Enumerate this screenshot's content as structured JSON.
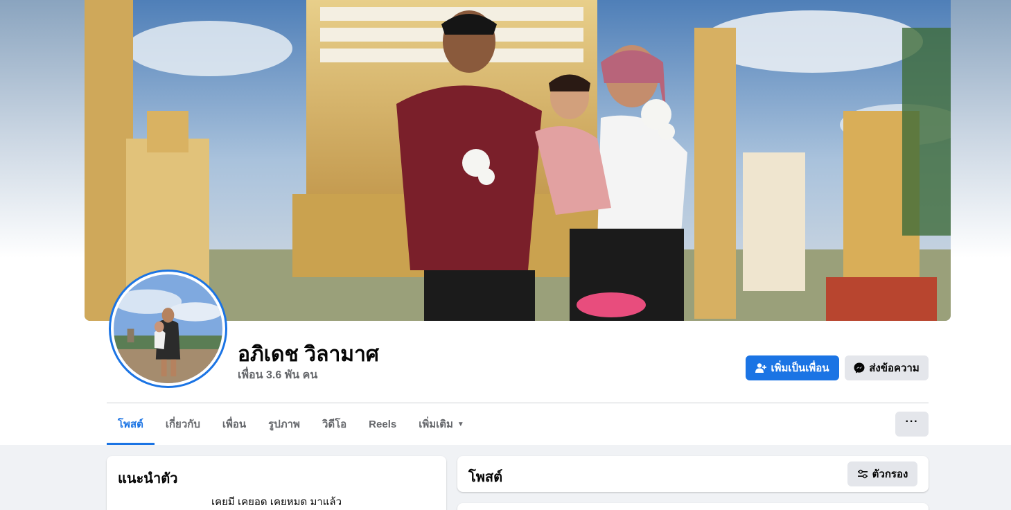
{
  "profile": {
    "name": "อภิเดช วิลามาศ",
    "friends_count": "เพื่อน 3.6 พัน คน"
  },
  "actions": {
    "add_friend_label": "เพิ่มเป็นเพื่อน",
    "message_label": "ส่งข้อความ",
    "more_label": "···"
  },
  "tabs": [
    {
      "label": "โพสต์",
      "active": true
    },
    {
      "label": "เกี่ยวกับ",
      "active": false
    },
    {
      "label": "เพื่อน",
      "active": false
    },
    {
      "label": "รูปภาพ",
      "active": false
    },
    {
      "label": "วิดีโอ",
      "active": false
    },
    {
      "label": "Reels",
      "active": false
    },
    {
      "label": "เพิ่มเติม",
      "active": false
    }
  ],
  "intro": {
    "title": "แนะนำตัว",
    "bio": "เคยมี เคยอด เคยหมด มาแล้ว"
  },
  "posts": {
    "title": "โพสต์",
    "filter_label": "ตัวกรอง"
  },
  "colors": {
    "accent": "#1b74e4",
    "secondary_button": "#e4e6eb",
    "page_background": "#f0f2f5",
    "muted_text": "#65676b"
  },
  "icons": {
    "add_friend": "user-plus-icon",
    "message": "messenger-icon",
    "more": "ellipsis-icon",
    "dropdown": "caret-down-icon",
    "filter": "filter-sliders-icon"
  }
}
